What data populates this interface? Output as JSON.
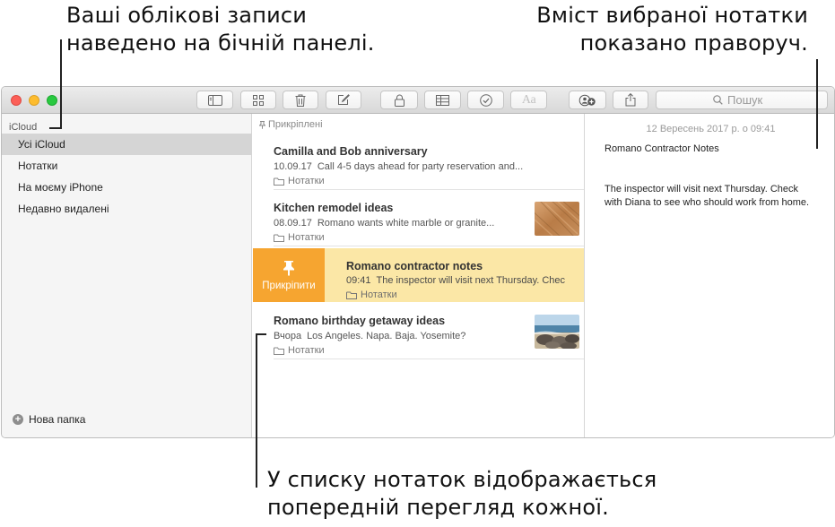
{
  "callouts": {
    "sidebar": [
      "Ваші облікові записи",
      "наведено на бічній панелі."
    ],
    "content": [
      "Вміст вибраної нотатки",
      "показано праворуч."
    ],
    "list": [
      "У списку нотаток відображається",
      "попередній перегляд кожної."
    ]
  },
  "toolbar": {
    "aa_label": "Aa",
    "search_placeholder": "Пошук",
    "icons": [
      "sidebar-toggle-icon",
      "gallery-view-icon",
      "trash-icon",
      "compose-icon",
      "lock-icon",
      "table-icon",
      "checklist-icon",
      "text-format-icon",
      "add-people-icon",
      "share-icon",
      "search-icon"
    ]
  },
  "sidebar": {
    "account": "iCloud",
    "items": [
      {
        "label": "Усі iCloud",
        "selected": true
      },
      {
        "label": "Нотатки",
        "selected": false
      },
      {
        "label": "На моєму iPhone",
        "selected": false
      },
      {
        "label": "Недавно видалені",
        "selected": false
      }
    ],
    "new_folder": "Нова папка"
  },
  "notes_list": {
    "pinned_header": "Прикріплені",
    "notes": [
      {
        "title": "Camilla and Bob anniversary",
        "date": "10.09.17",
        "preview": "Call 4-5 days ahead for party reservation and...",
        "folder": "Нотатки"
      },
      {
        "title": "Kitchen remodel ideas",
        "date": "08.09.17",
        "preview": "Romano wants white marble or granite...",
        "folder": "Нотатки"
      },
      {
        "title": "Romano contractor notes",
        "date": "09:41",
        "preview": "The inspector will visit next Thursday. Chec",
        "folder": "Нотатки",
        "swipe_action": "Прикріпити"
      },
      {
        "title": "Romano birthday getaway ideas",
        "date": "Вчора",
        "preview": "Los Angeles. Napa. Baja. Yosemite?",
        "folder": "Нотатки"
      }
    ]
  },
  "content": {
    "date": "12 Вересень 2017 р. о 09:41",
    "title": "Romano Contractor Notes",
    "body": "The inspector will visit next Thursday. Check with Diana to see who should work from home."
  },
  "colors": {
    "swipe_action": "#f6a530",
    "selected_note": "#fbe7a6",
    "sidebar_selected": "#d5d5d5"
  }
}
